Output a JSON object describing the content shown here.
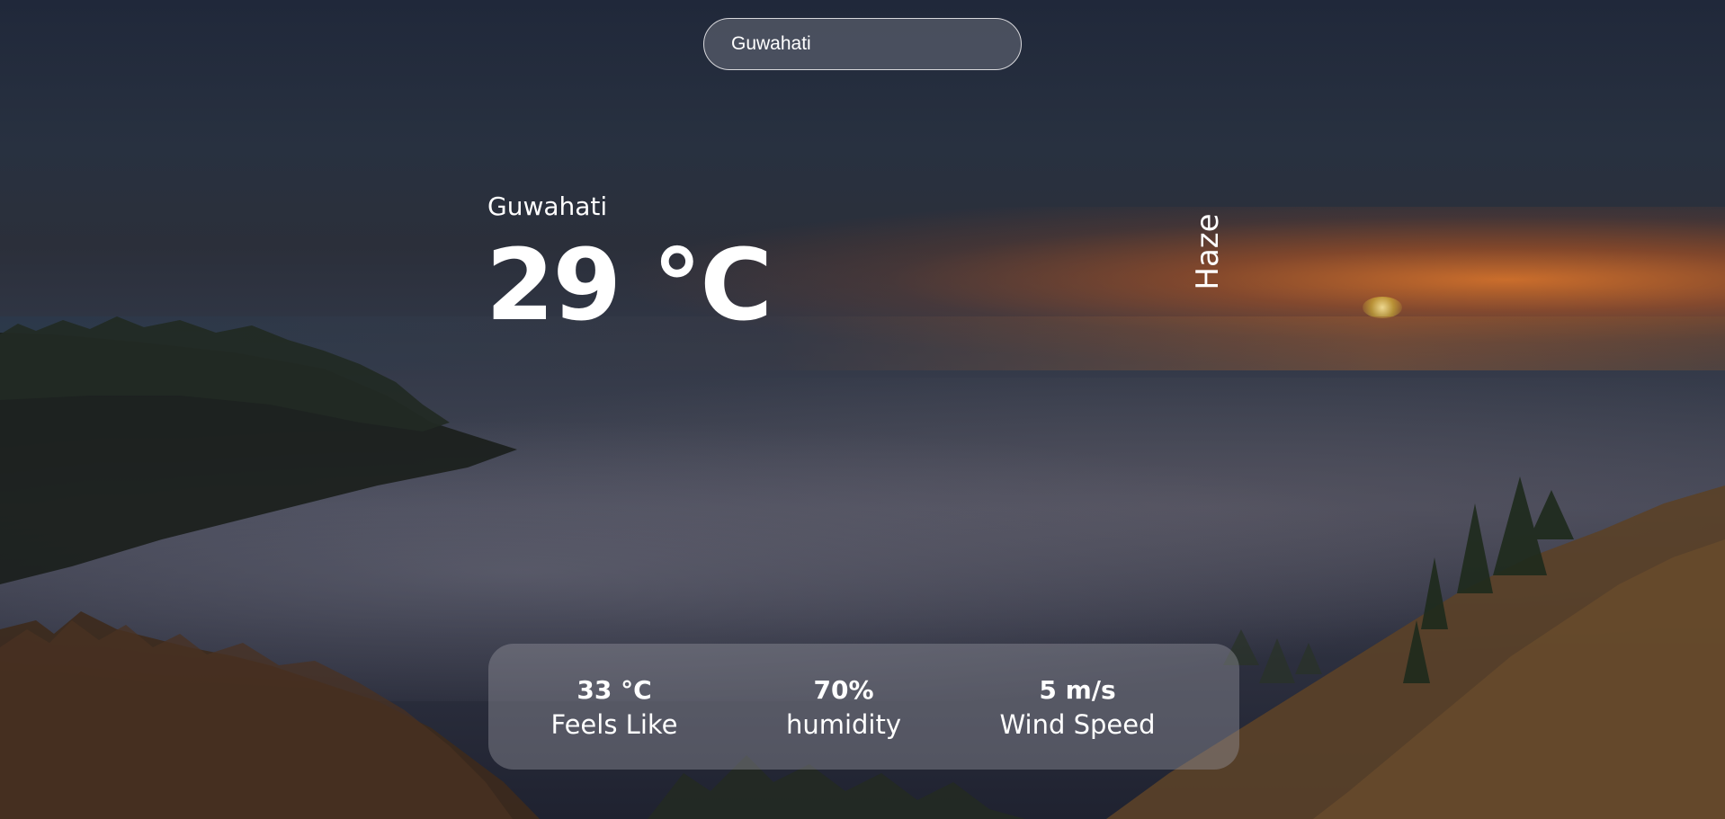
{
  "search": {
    "value": "Guwahati"
  },
  "weather": {
    "city": "Guwahati",
    "temperature": "29 °C",
    "condition": "Haze"
  },
  "stats": {
    "feels_like_value": "33 °C",
    "feels_like_label": "Feels Like",
    "humidity_value": "70%",
    "humidity_label": "humidity",
    "wind_value": "5 m/s",
    "wind_label": "Wind Speed"
  },
  "colors": {
    "text": "#ffffff",
    "search_border": "#d8d8dc",
    "card_background": "rgba(150,150,160,0.42)"
  }
}
